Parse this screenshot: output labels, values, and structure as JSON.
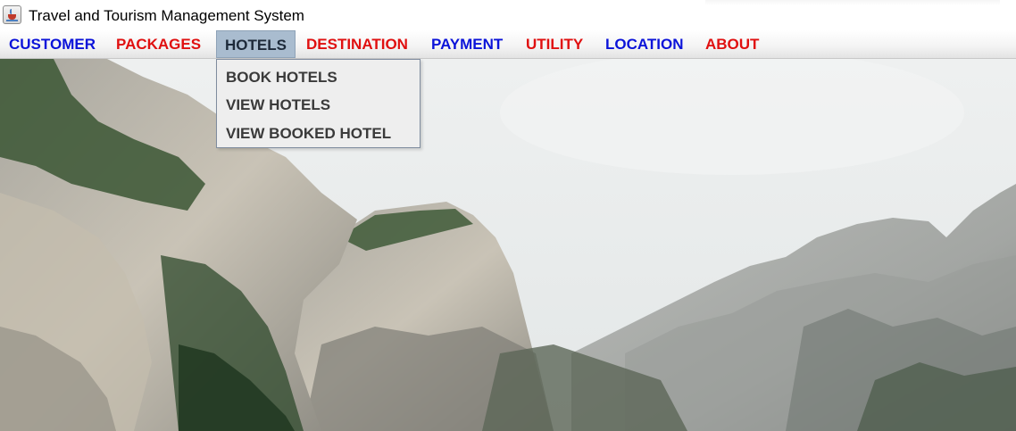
{
  "window": {
    "title": "Travel and Tourism Management System",
    "icon": "java-app-icon"
  },
  "menubar": {
    "items": [
      {
        "label": "CUSTOMER",
        "color": "#0b13d9"
      },
      {
        "label": "PACKAGES",
        "color": "#e01010"
      },
      {
        "label": "HOTELS",
        "color": "#1d2a3a",
        "selected": true
      },
      {
        "label": "DESTINATION",
        "color": "#e01010"
      },
      {
        "label": "PAYMENT",
        "color": "#0b13d9"
      },
      {
        "label": "UTILITY",
        "color": "#e01010"
      },
      {
        "label": "LOCATION",
        "color": "#0b13d9"
      },
      {
        "label": "ABOUT",
        "color": "#e01010"
      }
    ]
  },
  "hotels_menu": {
    "items": [
      {
        "label": "BOOK HOTELS"
      },
      {
        "label": "VIEW HOTELS"
      },
      {
        "label": "VIEW BOOKED HOTEL"
      }
    ]
  },
  "background": {
    "description_icon": "mountain-landscape-image",
    "sky_color": "#e6eaea",
    "rock_color": "#b8b6ae",
    "tree_color": "#2f4a2c"
  }
}
